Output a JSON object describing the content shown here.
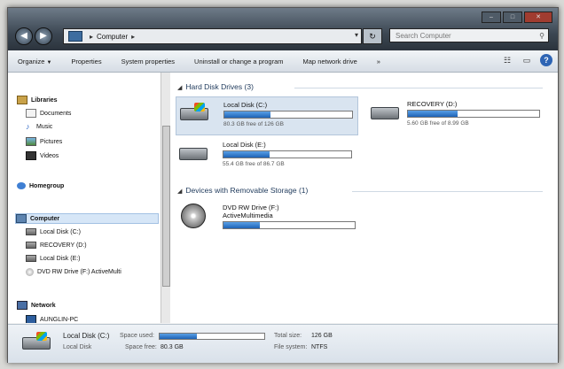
{
  "address": {
    "crumbs": [
      "Computer"
    ]
  },
  "search": {
    "placeholder": "Search Computer"
  },
  "toolbar": {
    "organize": "Organize",
    "properties": "Properties",
    "system_properties": "System properties",
    "uninstall": "Uninstall or change a program",
    "map_drive": "Map network drive"
  },
  "nav": {
    "libraries": "Libraries",
    "documents": "Documents",
    "music": "Music",
    "pictures": "Pictures",
    "videos": "Videos",
    "homegroup": "Homegroup",
    "computer": "Computer",
    "local_c": "Local Disk (C:)",
    "recovery_d": "RECOVERY (D:)",
    "local_e": "Local Disk (E:)",
    "dvd_f": "DVD RW Drive (F:) ActiveMulti",
    "network": "Network",
    "aunglin": "AUNGLIN-PC"
  },
  "groups": {
    "hdd": "Hard Disk Drives (3)",
    "removable": "Devices with Removable Storage (1)"
  },
  "drives": {
    "c": {
      "name": "Local Disk (C:)",
      "free": "80.3 GB free of 126 GB",
      "used_fraction": 0.36
    },
    "d": {
      "name": "RECOVERY (D:)",
      "free": "5.60 GB free of 8.99 GB",
      "used_fraction": 0.38
    },
    "e": {
      "name": "Local Disk (E:)",
      "free": "55.4 GB free of 86.7 GB",
      "used_fraction": 0.36
    },
    "f": {
      "name": "DVD RW Drive (F:)",
      "label": "ActiveMultimedia",
      "used_fraction": 0.28
    }
  },
  "details": {
    "name": "Local Disk (C:)",
    "type": "Local Disk",
    "space_used_label": "Space used:",
    "space_free_label": "Space free:",
    "space_free": "80.3 GB",
    "total_size_label": "Total size:",
    "total_size": "126 GB",
    "filesystem_label": "File system:",
    "filesystem": "NTFS",
    "used_fraction": 0.36
  }
}
